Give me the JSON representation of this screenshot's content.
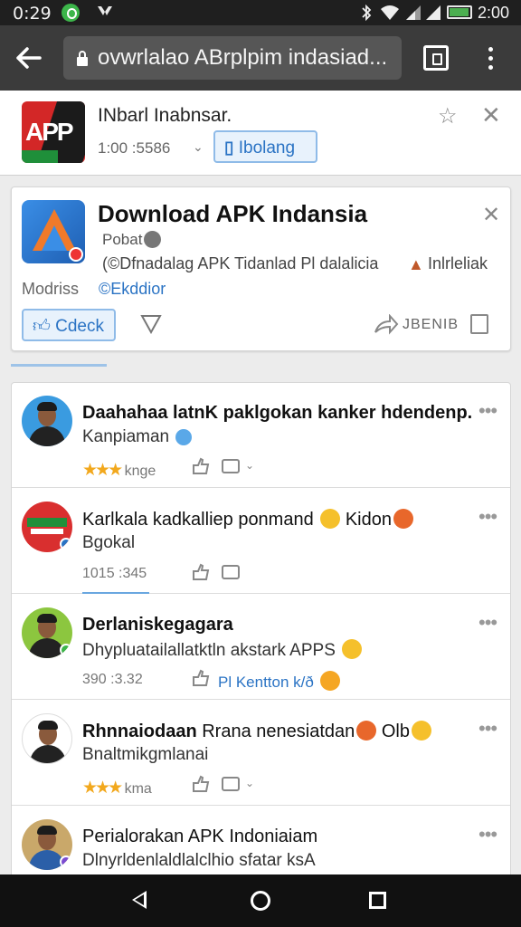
{
  "status_bar": {
    "time": "0:29",
    "right_time": "2:00",
    "battery_level": 0.95,
    "icons": [
      "notification-icon",
      "download-icon",
      "bluetooth-icon",
      "wifi-icon",
      "signal-icon",
      "signal-icon",
      "battery-icon"
    ]
  },
  "browser": {
    "url": "ovwrlalao ABrplpim indasiad...",
    "colors": {
      "toolbar": "#3b3b3b",
      "url_box": "#565656"
    }
  },
  "app_banner": {
    "title": "INbarl Inabnsar.",
    "count": "1:00 :5586",
    "caret": "⌄",
    "button_label": "Ibolang",
    "logo_text": "APP"
  },
  "featured_card": {
    "title": "Download APK Indansia",
    "subtitle": "Pobat",
    "description": "(©Dfnadalag APK Tidanlad Pl dalalicia",
    "description_tail": "Inlrleliak",
    "mod_label": "Modriss",
    "mod_link": "©Ekddior",
    "check_button": "Cdeck",
    "share_label": "JBENIB",
    "accent_color": "#2a73c4"
  },
  "feed": {
    "posts": [
      {
        "title": "Daahahaa latnK paklgokan kanker hdendenp.",
        "subtitle": "Kanpiaman",
        "meta": "knge",
        "stars": "★★★",
        "has_caret": true,
        "avatar_bg": "#3a9be0",
        "badge": "",
        "subtitle_emoji": "#5aa8e8"
      },
      {
        "title": "Karlkala kadkalliep ponmand",
        "title_tail": "Kidon",
        "subtitle": "Bgokal",
        "meta": "1015 :345",
        "stars": "",
        "has_caret": false,
        "avatar_bg": "#d92f2f",
        "badge": "#2a73c4"
      },
      {
        "title": "Derlaniskegagara",
        "subtitle": "Dhypluatailallatktln akstark APPS",
        "meta": "390 :3.32",
        "stars": "",
        "extra": "Pl Kentton k/ð",
        "has_caret": false,
        "avatar_bg": "#8cc63f",
        "badge": "#3cb54a"
      },
      {
        "title": "Rhnnaiodaan",
        "title_rest": "Rrana nenesiatdan",
        "title_tail": "Olb",
        "subtitle": "Bnaltmikgmlanai",
        "meta": "kma",
        "stars": "★★★",
        "has_caret": true,
        "avatar_bg": "#ffffff",
        "badge": ""
      },
      {
        "title": "Perialorakan APK Indoniaiam",
        "subtitle": "Dlnyrldenlaldlalclhio sfatar ksA",
        "meta": "",
        "stars": "",
        "has_caret": false,
        "avatar_bg": "#c9a86a",
        "badge": "#7b4bd1"
      }
    ]
  }
}
